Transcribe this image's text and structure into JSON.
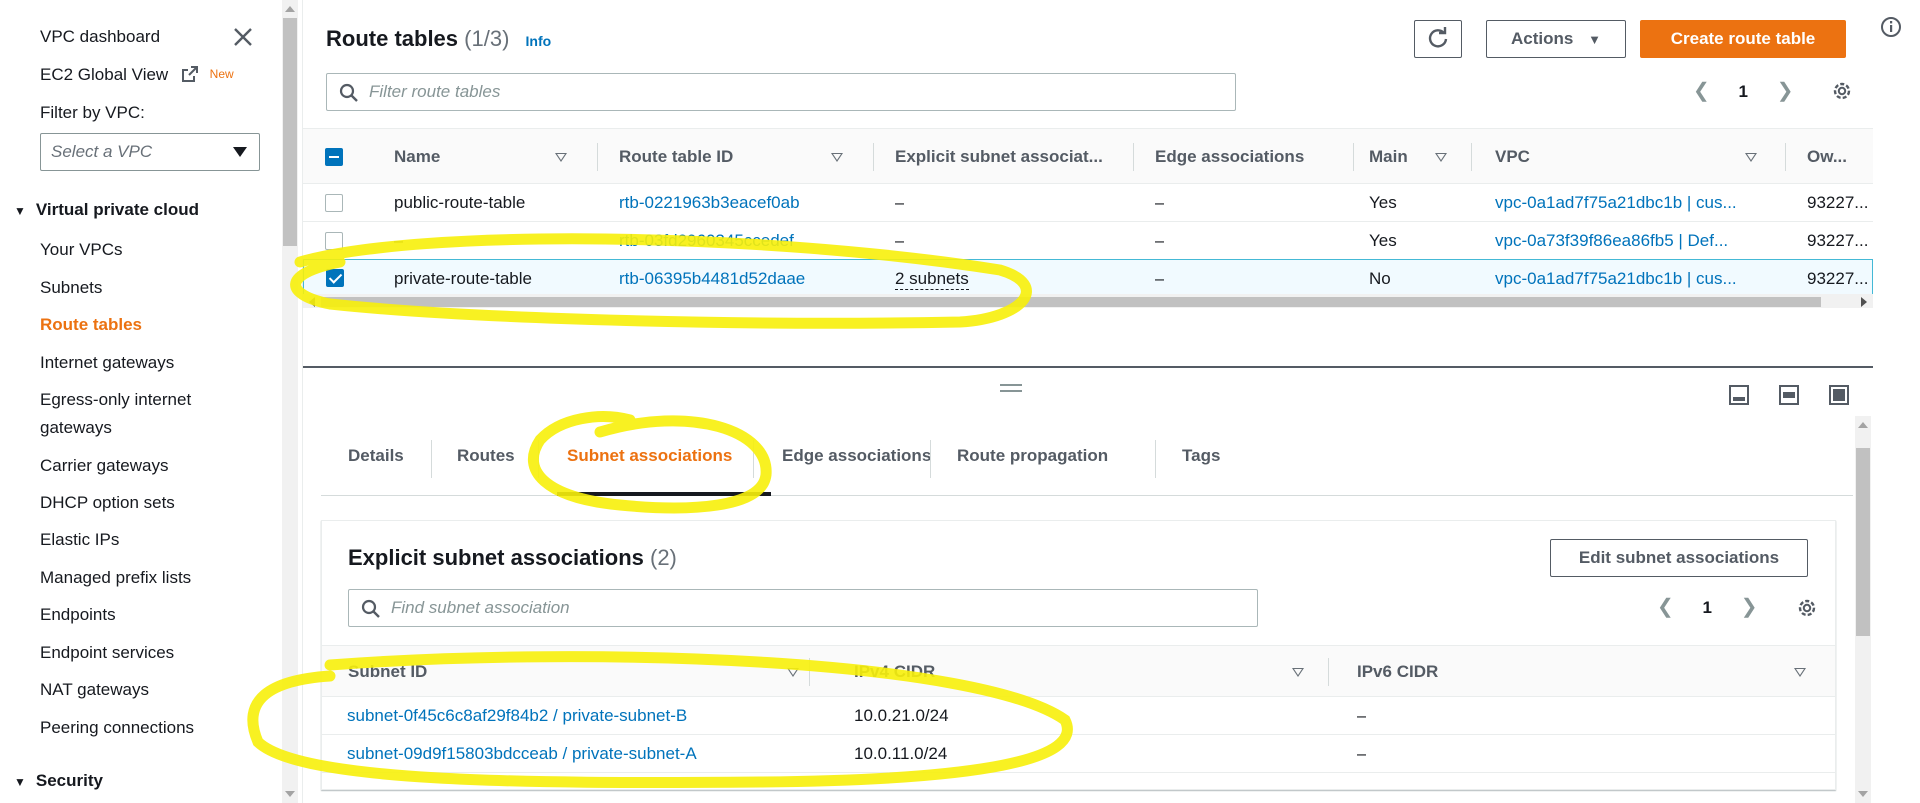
{
  "sidebar": {
    "top_items": [
      {
        "label": "VPC dashboard"
      },
      {
        "label": "EC2 Global View",
        "badge": "New"
      }
    ],
    "filter_label": "Filter by VPC:",
    "filter_placeholder": "Select a VPC",
    "section_vpc": "Virtual private cloud",
    "items": [
      {
        "label": "Your VPCs"
      },
      {
        "label": "Subnets"
      },
      {
        "label": "Route tables",
        "active": true
      },
      {
        "label": "Internet gateways"
      },
      {
        "label": "Egress-only internet"
      },
      {
        "label": "gateways"
      },
      {
        "label": "Carrier gateways"
      },
      {
        "label": "DHCP option sets"
      },
      {
        "label": "Elastic IPs"
      },
      {
        "label": "Managed prefix lists"
      },
      {
        "label": "Endpoints"
      },
      {
        "label": "Endpoint services"
      },
      {
        "label": "NAT gateways"
      },
      {
        "label": "Peering connections"
      }
    ],
    "section_security": "Security"
  },
  "route_tables": {
    "title": "Route tables",
    "count": "(1/3)",
    "info": "Info",
    "actions_label": "Actions",
    "create_label": "Create route table",
    "search_placeholder": "Filter route tables",
    "page": "1",
    "columns": [
      "Name",
      "Route table ID",
      "Explicit subnet associat...",
      "Edge associations",
      "Main",
      "VPC",
      "Ow..."
    ],
    "rows": [
      {
        "name": "public-route-table",
        "id": "rtb-0221963b3eacef0ab",
        "explicit": "–",
        "edge": "–",
        "main": "Yes",
        "vpc": "vpc-0a1ad7f75a21dbc1b | cus...",
        "owner": "93227...",
        "selected": false
      },
      {
        "name": "–",
        "id": "rtb-03fd2960345ccedef",
        "explicit": "–",
        "edge": "–",
        "main": "Yes",
        "vpc": "vpc-0a73f39f86ea86fb5 | Def...",
        "owner": "93227...",
        "selected": false
      },
      {
        "name": "private-route-table",
        "id": "rtb-06395b4481d52daae",
        "explicit": "2 subnets",
        "edge": "–",
        "main": "No",
        "vpc": "vpc-0a1ad7f75a21dbc1b | cus...",
        "owner": "93227...",
        "selected": true
      }
    ]
  },
  "detail_tabs": [
    "Details",
    "Routes",
    "Subnet associations",
    "Edge associations",
    "Route propagation",
    "Tags"
  ],
  "subnet_assoc": {
    "title": "Explicit subnet associations",
    "count": "(2)",
    "edit_label": "Edit subnet associations",
    "search_placeholder": "Find subnet association",
    "page": "1",
    "columns": [
      "Subnet ID",
      "IPv4 CIDR",
      "IPv6 CIDR"
    ],
    "rows": [
      {
        "subnet": "subnet-0f45c6c8af29f84b2 / private-subnet-B",
        "ipv4": "10.0.21.0/24",
        "ipv6": "–"
      },
      {
        "subnet": "subnet-09d9f15803bdcceab / private-subnet-A",
        "ipv4": "10.0.11.0/24",
        "ipv6": "–"
      }
    ]
  },
  "colors": {
    "accent": "#ec7211",
    "link": "#0073bb",
    "highlight": "#f7f00a"
  }
}
